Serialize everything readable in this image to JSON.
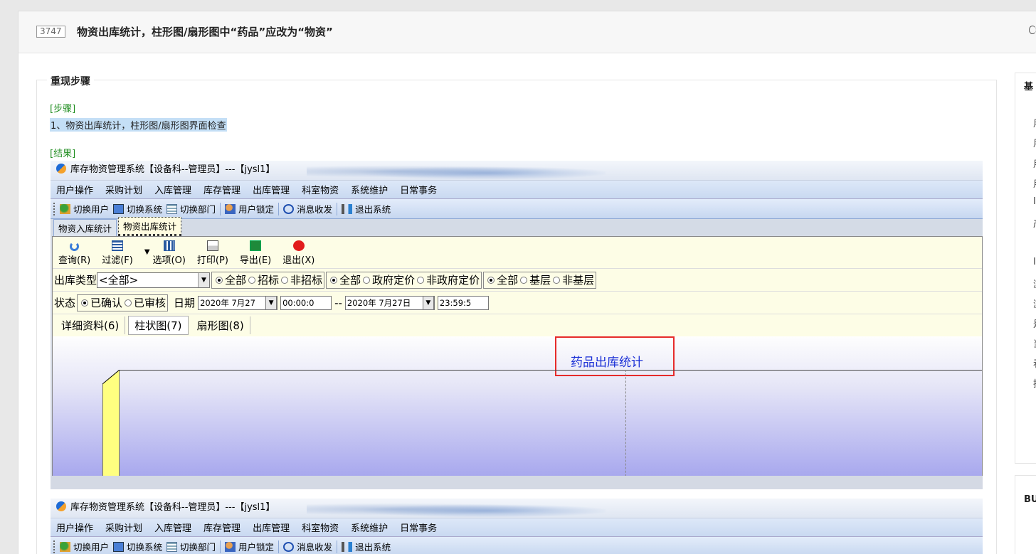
{
  "bug": {
    "id": "3747",
    "title": "物资出库统计，柱形图/扇形图中“药品”应改为“物资”"
  },
  "section": {
    "legend": "重现步骤",
    "steps_label": "[步骤]",
    "step_1": "1、物资出库统计，柱形图/扇形图界面检查",
    "result_label": "[结果]"
  },
  "side": {
    "head": "基",
    "chars": [
      "用",
      "用",
      "用",
      "用",
      "I",
      "产",
      "",
      "I",
      "浏",
      "浏",
      "是",
      "当",
      "看",
      "执"
    ],
    "head2": "BU"
  },
  "app": {
    "title": "库存物资管理系统【设备科--管理员】---【jysl1】",
    "menus": [
      "用户操作",
      "采购计划",
      "入库管理",
      "库存管理",
      "出库管理",
      "科室物资",
      "系统维护",
      "日常事务"
    ],
    "tools": [
      "切换用户",
      "切换系统",
      "切换部门",
      "用户锁定",
      "消息收发",
      "退出系统"
    ],
    "tabs": [
      "物资入库统计",
      "物资出库统计"
    ],
    "buttons": [
      "查询(R)",
      "过滤(F)",
      "选项(O)",
      "打印(P)",
      "导出(E)",
      "退出(X)"
    ],
    "filter": {
      "type_label": "出库类型",
      "type_value": "<全部>",
      "g1": [
        "全部",
        "招标",
        "非招标"
      ],
      "g2": [
        "全部",
        "政府定价",
        "非政府定价"
      ],
      "g3": [
        "全部",
        "基层",
        "非基层"
      ]
    },
    "status": {
      "label": "状态",
      "opts": [
        "已确认",
        "已审核"
      ],
      "date_label": "日期",
      "d1": "2020年 7月27",
      "t1": "00:00:0",
      "sep": "--",
      "d2": "2020年 7月27日",
      "t2": "23:59:5"
    },
    "subtabs": [
      "详细资料(6)",
      "柱状图(7)",
      "扇形图(8)"
    ],
    "chart_title": "药品出库统计"
  }
}
